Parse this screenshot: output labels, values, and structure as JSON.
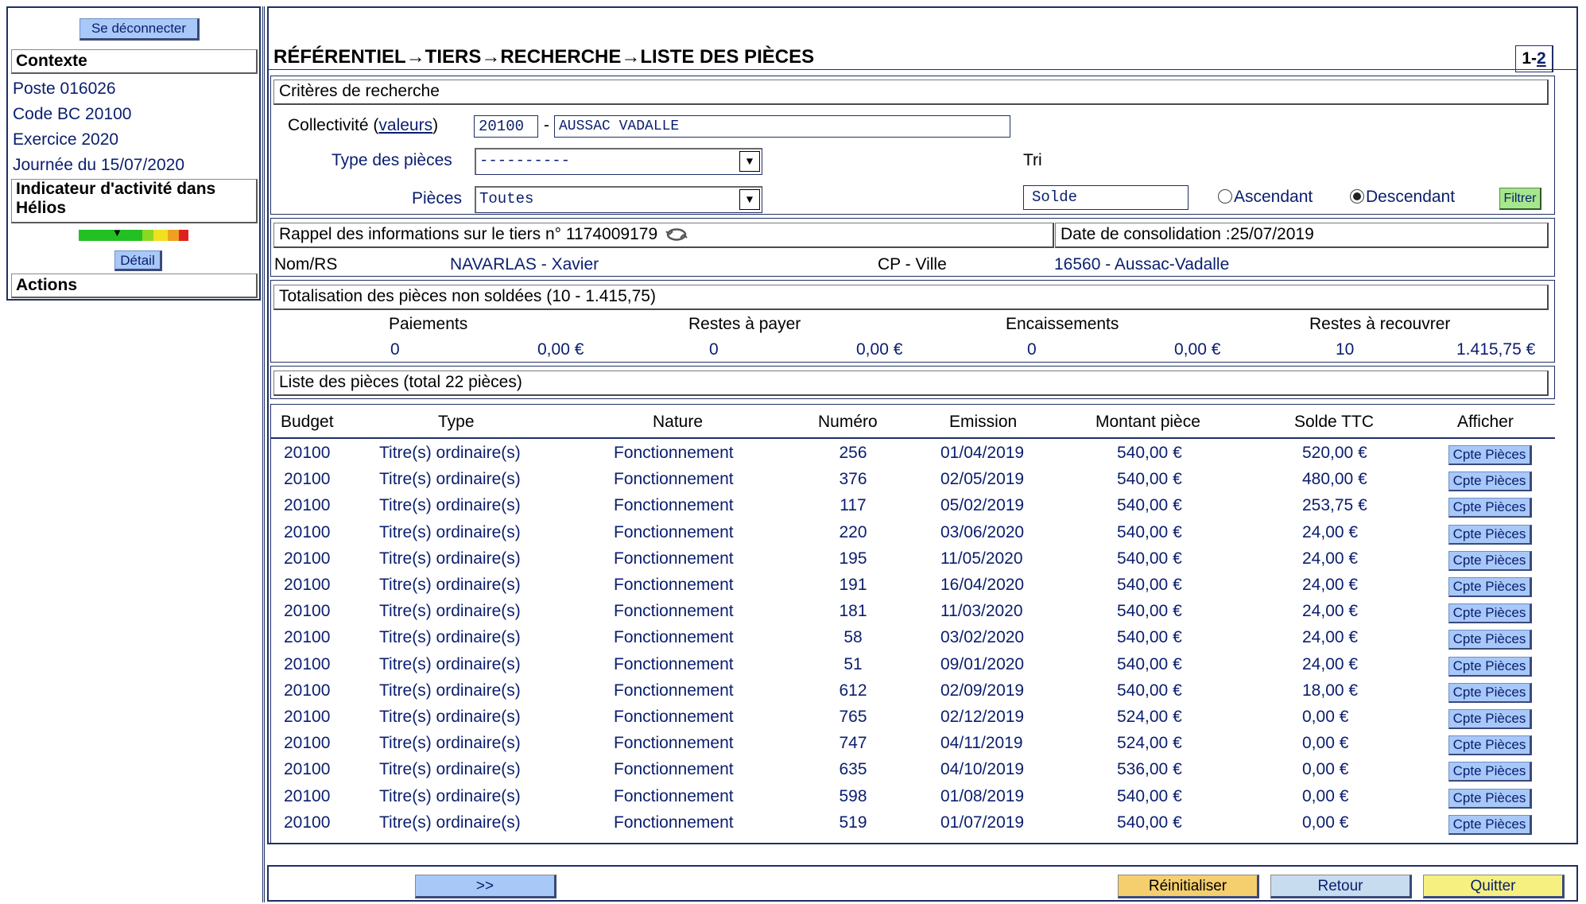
{
  "sidebar": {
    "logout_label": "Se déconnecter",
    "context_heading": "Contexte",
    "context_items": [
      "Poste 016026",
      "Code BC 20100",
      "Exercice 2020",
      "Journée du 15/07/2020"
    ],
    "activity_heading_line1": "Indicateur d'activité dans",
    "activity_heading_line2": "Hélios",
    "gauge_colors": [
      "#22c022",
      "#22c022",
      "#22c022",
      "#22c022",
      "#8ad822",
      "#f0e020",
      "#f0a020",
      "#e02020"
    ],
    "detail_label": "Détail",
    "actions_heading": "Actions"
  },
  "header": {
    "title": "RÉFÉRENTIEL→TIERS→RECHERCHE→LISTE DES PIÈCES",
    "page_current": "1-",
    "page_link": "2"
  },
  "criteria": {
    "heading": "Critères de recherche",
    "collectivite_label": "Collectivité",
    "valeurs_link": "valeurs",
    "paren_open": "(",
    "paren_close": ")",
    "collectivite_code": "20100",
    "dash": "-",
    "collectivite_name": "AUSSAC VADALLE",
    "type_label": "Type des pièces",
    "type_value": "----------",
    "pieces_label": "Pièces",
    "pieces_value": "Toutes",
    "tri_label": "Tri",
    "tri_value": "Solde",
    "asc_label": "Ascendant",
    "desc_label": "Descendant",
    "filter_button": "Filtrer"
  },
  "tiers": {
    "heading": "Rappel des informations sur le tiers n° 1174009179",
    "consolidation": "Date de consolidation :25/07/2019",
    "nom_label": "Nom/RS",
    "nom_value": "NAVARLAS - Xavier",
    "cp_label": "CP - Ville",
    "cp_value": "16560 - Aussac-Vadalle"
  },
  "totals": {
    "heading": "Totalisation des pièces non soldées  (10 -  1.415,75)",
    "col_labels": [
      "Paiements",
      "Restes à payer",
      "Encaissements",
      "Restes à recouvrer"
    ],
    "counts": [
      "0",
      "0",
      "0",
      "10"
    ],
    "amounts": [
      "0,00 €",
      "0,00 €",
      "0,00 €",
      "1.415,75 €"
    ]
  },
  "list": {
    "heading": "Liste des pièces (total 22 pièces)",
    "columns": [
      "Budget",
      "Type",
      "Nature",
      "Numéro",
      "Emission",
      "Montant pièce",
      "Solde TTC",
      "Afficher"
    ],
    "button_label": "Cpte Pièces",
    "rows": [
      [
        "20100",
        "Titre(s) ordinaire(s)",
        "Fonctionnement",
        "256",
        "01/04/2019",
        "540,00 €",
        "520,00 €"
      ],
      [
        "20100",
        "Titre(s) ordinaire(s)",
        "Fonctionnement",
        "376",
        "02/05/2019",
        "540,00 €",
        "480,00 €"
      ],
      [
        "20100",
        "Titre(s) ordinaire(s)",
        "Fonctionnement",
        "117",
        "05/02/2019",
        "540,00 €",
        "253,75 €"
      ],
      [
        "20100",
        "Titre(s) ordinaire(s)",
        "Fonctionnement",
        "220",
        "03/06/2020",
        "540,00 €",
        "24,00 €"
      ],
      [
        "20100",
        "Titre(s) ordinaire(s)",
        "Fonctionnement",
        "195",
        "11/05/2020",
        "540,00 €",
        "24,00 €"
      ],
      [
        "20100",
        "Titre(s) ordinaire(s)",
        "Fonctionnement",
        "191",
        "16/04/2020",
        "540,00 €",
        "24,00 €"
      ],
      [
        "20100",
        "Titre(s) ordinaire(s)",
        "Fonctionnement",
        "181",
        "11/03/2020",
        "540,00 €",
        "24,00 €"
      ],
      [
        "20100",
        "Titre(s) ordinaire(s)",
        "Fonctionnement",
        "58",
        "03/02/2020",
        "540,00 €",
        "24,00 €"
      ],
      [
        "20100",
        "Titre(s) ordinaire(s)",
        "Fonctionnement",
        "51",
        "09/01/2020",
        "540,00 €",
        "24,00 €"
      ],
      [
        "20100",
        "Titre(s) ordinaire(s)",
        "Fonctionnement",
        "612",
        "02/09/2019",
        "540,00 €",
        "18,00 €"
      ],
      [
        "20100",
        "Titre(s) ordinaire(s)",
        "Fonctionnement",
        "765",
        "02/12/2019",
        "524,00 €",
        "0,00 €"
      ],
      [
        "20100",
        "Titre(s) ordinaire(s)",
        "Fonctionnement",
        "747",
        "04/11/2019",
        "524,00 €",
        "0,00 €"
      ],
      [
        "20100",
        "Titre(s) ordinaire(s)",
        "Fonctionnement",
        "635",
        "04/10/2019",
        "536,00 €",
        "0,00 €"
      ],
      [
        "20100",
        "Titre(s) ordinaire(s)",
        "Fonctionnement",
        "598",
        "01/08/2019",
        "540,00 €",
        "0,00 €"
      ],
      [
        "20100",
        "Titre(s) ordinaire(s)",
        "Fonctionnement",
        "519",
        "01/07/2019",
        "540,00 €",
        "0,00 €"
      ]
    ]
  },
  "footer": {
    "next_label": ">>",
    "reset_label": "Réinitialiser",
    "back_label": "Retour",
    "quit_label": "Quitter",
    "next_color": "#a8c8f8",
    "reset_color": "#f5cf6e",
    "back_color": "#c8dcf0",
    "quit_color": "#f5f080"
  }
}
